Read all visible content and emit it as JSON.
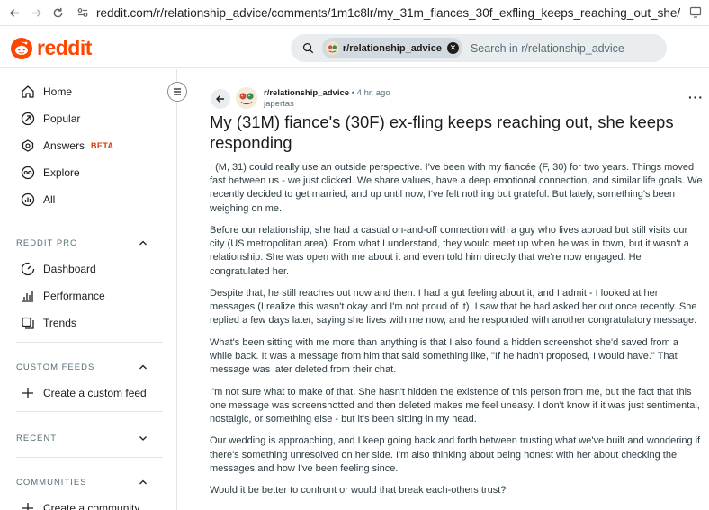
{
  "browser": {
    "url": "reddit.com/r/relationship_advice/comments/1m1c8lr/my_31m_fiances_30f_exfling_keeps_reaching_out_she/"
  },
  "header": {
    "logo_text": "reddit",
    "search_chip": "r/relationship_advice",
    "search_placeholder": "Search in r/relationship_advice",
    "brand_color": "#ff4500"
  },
  "sidebar": {
    "main_items": [
      {
        "label": "Home",
        "icon": "home-icon"
      },
      {
        "label": "Popular",
        "icon": "popular-icon"
      },
      {
        "label": "Answers",
        "icon": "answers-icon",
        "badge": "BETA"
      },
      {
        "label": "Explore",
        "icon": "explore-icon"
      },
      {
        "label": "All",
        "icon": "all-icon"
      }
    ],
    "reddit_pro": {
      "heading": "REDDIT PRO",
      "items": [
        {
          "label": "Dashboard",
          "icon": "dashboard-icon"
        },
        {
          "label": "Performance",
          "icon": "performance-icon"
        },
        {
          "label": "Trends",
          "icon": "trends-icon"
        }
      ]
    },
    "custom_feeds": {
      "heading": "CUSTOM FEEDS",
      "items": [
        {
          "label": "Create a custom feed",
          "icon": "plus-icon"
        }
      ]
    },
    "recent": {
      "heading": "RECENT"
    },
    "communities": {
      "heading": "COMMUNITIES",
      "items": [
        {
          "label": "Create a community",
          "icon": "plus-icon"
        }
      ]
    }
  },
  "post": {
    "subreddit": "r/relationship_advice",
    "time": "• 4 hr. ago",
    "author": "japertas",
    "title": "My (31M) fiance's (30F) ex-fling keeps reaching out, she keeps responding",
    "paragraphs": [
      "I (M, 31) could really use an outside perspective. I've been with my fiancée (F, 30) for two years. Things moved fast between us - we just clicked. We share values, have a deep emotional connection, and similar life goals. We recently decided to get married, and up until now, I've felt nothing but grateful. But lately, something's been weighing on me.",
      "Before our relationship, she had a casual on-and-off connection with a guy who lives abroad but still visits our city (US metropolitan area). From what I understand, they would meet up when he was in town, but it wasn't a relationship. She was open with me about it and even told him directly that we're now engaged. He congratulated her.",
      "Despite that, he still reaches out now and then. I had a gut feeling about it, and I admit - I looked at her messages (I realize this wasn't okay and I'm not proud of it). I saw that he had asked her out once recently. She replied a few days later, saying she lives with me now, and he responded with another congratulatory message.",
      "What's been sitting with me more than anything is that I also found a hidden screenshot she'd saved from a while back. It was a message from him that said something like, \"If he hadn't proposed, I would have.\" That message was later deleted from their chat.",
      "I'm not sure what to make of that. She hasn't hidden the existence of this person from me, but the fact that this one message was screenshotted and then deleted makes me feel uneasy. I don't know if it was just sentimental, nostalgic, or something else - but it's been sitting in my head.",
      "Our wedding is approaching, and I keep going back and forth between trusting what we've built and wondering if there's something unresolved on her side. I'm also thinking about being honest with her about checking the messages and how I've been feeling since.",
      "Would it be better to confront or would that break each-others trust?"
    ]
  }
}
